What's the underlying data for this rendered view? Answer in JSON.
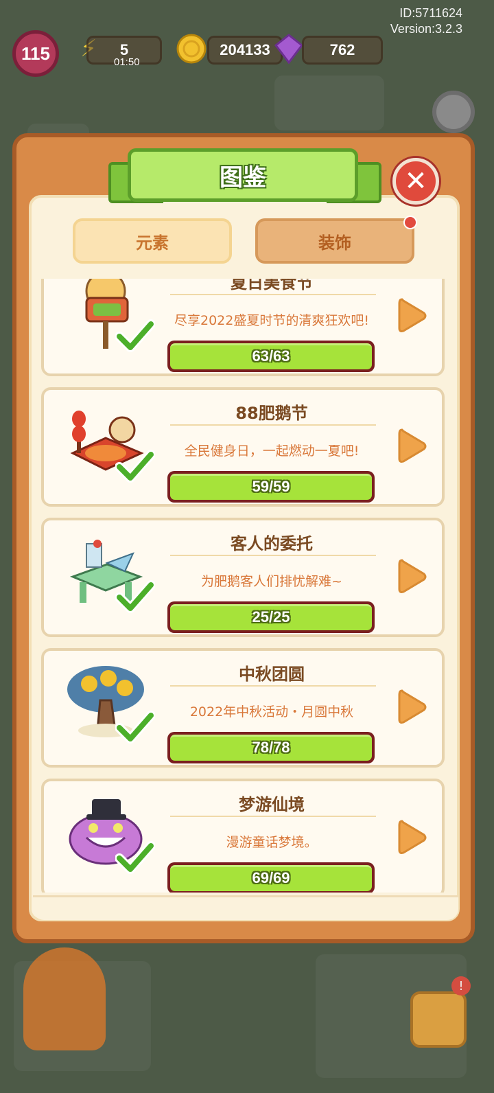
{
  "hud": {
    "id_text": "ID:5711624",
    "version_text": "Version:3.2.3",
    "level": "115",
    "energy": "5",
    "energy_timer": "01:50",
    "coins": "204133",
    "gems": "762"
  },
  "modal": {
    "title": "图鉴",
    "close_label": "✕",
    "tabs": [
      {
        "label": "元素",
        "selected": false
      },
      {
        "label": "装饰",
        "selected": true
      }
    ]
  },
  "collections": [
    {
      "title": "夏日美食节",
      "desc": "尽享2022盛夏时节的清爽狂欢吧!",
      "progress": "63/63",
      "fraction": 1.0,
      "icon": "open-sign-icon"
    },
    {
      "title": "88肥鹅节",
      "desc": "全民健身日，一起燃动一夏吧!",
      "progress": "59/59",
      "fraction": 1.0,
      "icon": "lantern-stage-icon"
    },
    {
      "title": "客人的委托",
      "desc": "为肥鹅客人们排忧解难~",
      "progress": "25/25",
      "fraction": 1.0,
      "icon": "craft-table-icon"
    },
    {
      "title": "中秋团圆",
      "desc": "2022年中秋活动・月圆中秋",
      "progress": "78/78",
      "fraction": 1.0,
      "icon": "golden-tree-icon"
    },
    {
      "title": "梦游仙境",
      "desc": "漫游童话梦境。",
      "progress": "69/69",
      "fraction": 1.0,
      "icon": "cheshire-cat-icon"
    }
  ],
  "colors": {
    "modal_orange": "#d98a48",
    "ribbon_green": "#b6ea6a",
    "progress_green": "#a6e33a",
    "close_red": "#e04a3c"
  }
}
